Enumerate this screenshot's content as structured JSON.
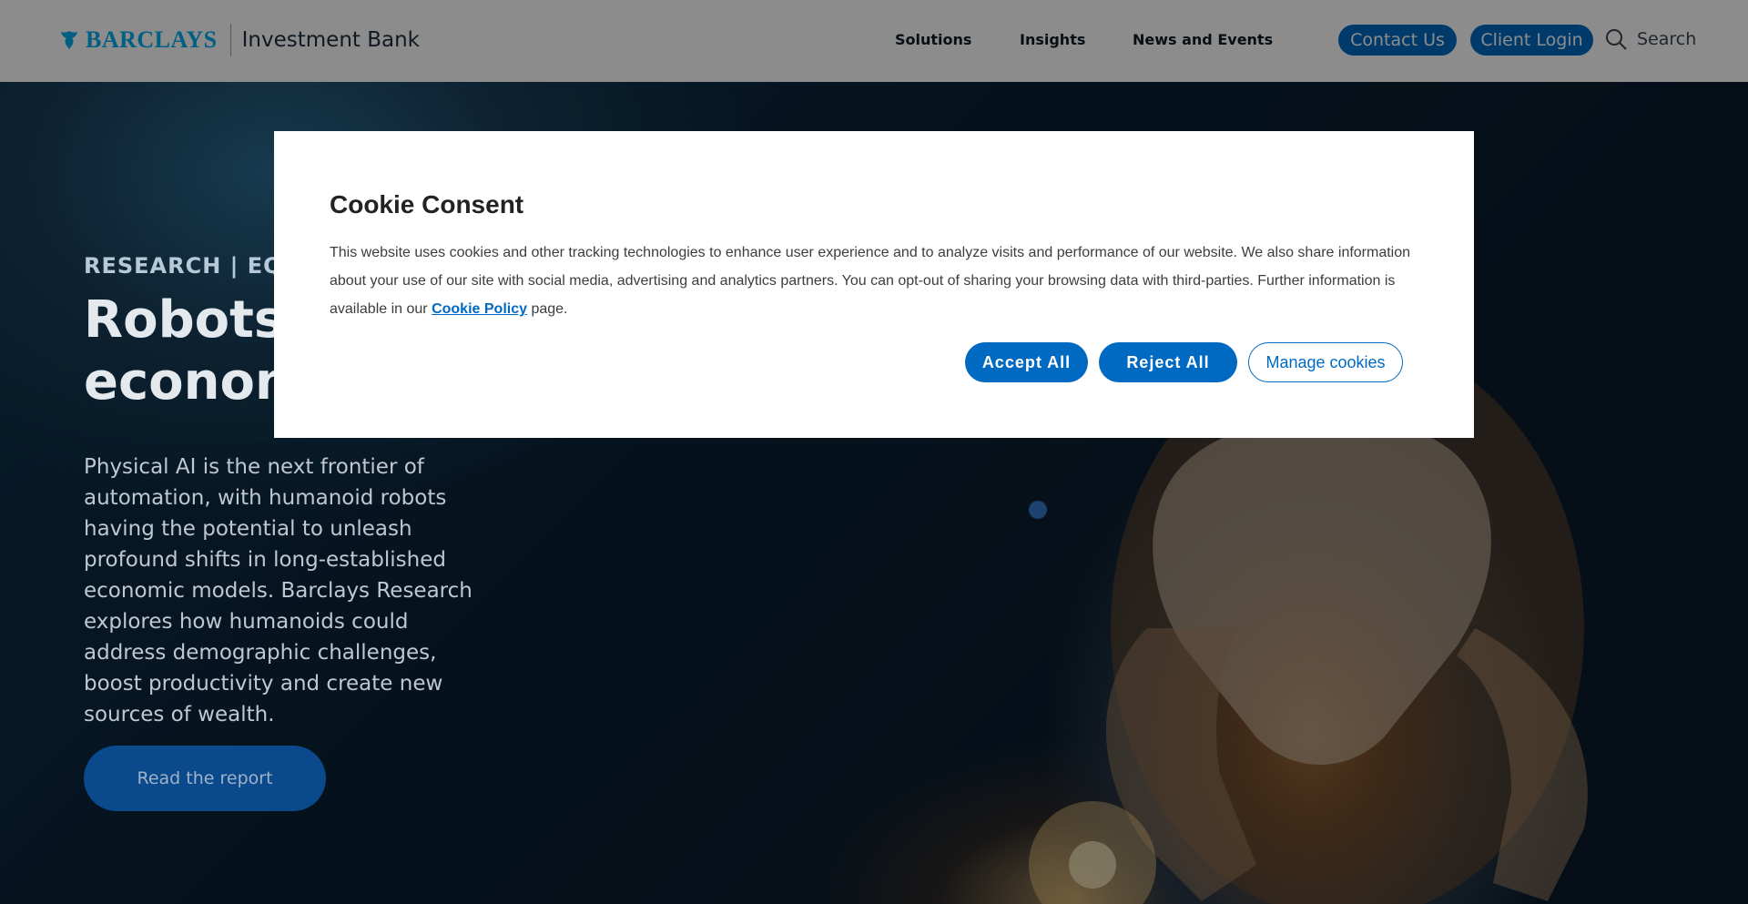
{
  "header": {
    "brand": "BARCLAYS",
    "division": "Investment Bank",
    "nav": [
      "Solutions",
      "Insights",
      "News and Events"
    ],
    "contact_label": "Contact Us",
    "login_label": "Client Login",
    "search_label": "Search"
  },
  "hero": {
    "eyebrow": "RESEARCH | EQUI",
    "title_line1": "Robots n",
    "title_line2": "economi",
    "description": "Physical AI is the next frontier of automation, with humanoid robots having the potential to unleash profound shifts in long-established economic models. Barclays Research explores how humanoids could address demographic challenges, boost productivity and create new sources of wealth.",
    "cta_label": "Read the report"
  },
  "cookie_modal": {
    "title": "Cookie Consent",
    "body_before_link": "This website uses cookies and other tracking technologies to enhance user experience and to analyze visits and performance of our website. We also share information about your use of our site with social media, advertising and analytics partners. You can opt-out of sharing your browsing data with third-parties. Further information is available in our ",
    "link_label": "Cookie Policy",
    "body_after_link": " page.",
    "accept_label": "Accept All",
    "reject_label": "Reject All",
    "manage_label": "Manage cookies"
  },
  "colors": {
    "brand_cyan": "#00aeef",
    "primary_blue": "#006ac3",
    "cta_blue": "#0a4a8c"
  },
  "icons": {
    "logo": "barclays-eagle-icon",
    "search": "search-icon"
  }
}
